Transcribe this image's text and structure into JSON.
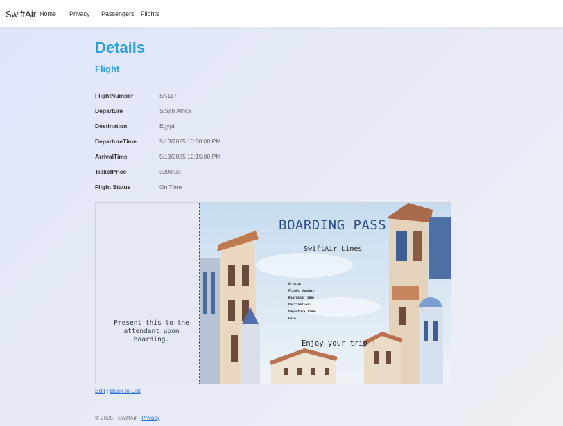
{
  "navbar": {
    "brand": "SwiftAir",
    "links": [
      "Home",
      "Privacy",
      "Passengers",
      "Flights"
    ]
  },
  "page": {
    "title": "Details",
    "subtitle": "Flight"
  },
  "details": [
    {
      "label": "FlightNumber",
      "value": "SA117"
    },
    {
      "label": "Departure",
      "value": "South Africa"
    },
    {
      "label": "Destination",
      "value": "Egypt"
    },
    {
      "label": "DepartureTime",
      "value": "9/13/2025 10:08:00 PM"
    },
    {
      "label": "ArrivalTime",
      "value": "9/13/2025 12:15:00 PM"
    },
    {
      "label": "TicketPrice",
      "value": "3200.00"
    },
    {
      "label": "Flight Status",
      "value": "On Time"
    }
  ],
  "boarding_pass": {
    "title": "BOARDING PASS",
    "airline": "SwiftAir  Lines",
    "fields": [
      "Origin:",
      "Flight Number:",
      "Boarding Time:",
      "Destination:",
      "Departure Time:",
      "Gate:"
    ],
    "enjoy": "Enjoy your trip !",
    "stub_text": "Present this to the attendant upon boarding."
  },
  "actions": {
    "edit": "Edit",
    "separator": " | ",
    "back": "Back to List"
  },
  "footer": {
    "text": "© 2025 - SwiftAir - ",
    "privacy": "Privacy"
  },
  "colors": {
    "accent": "#2e9fd8",
    "link": "#2b6fd6",
    "pass_title": "#2c4f86"
  }
}
